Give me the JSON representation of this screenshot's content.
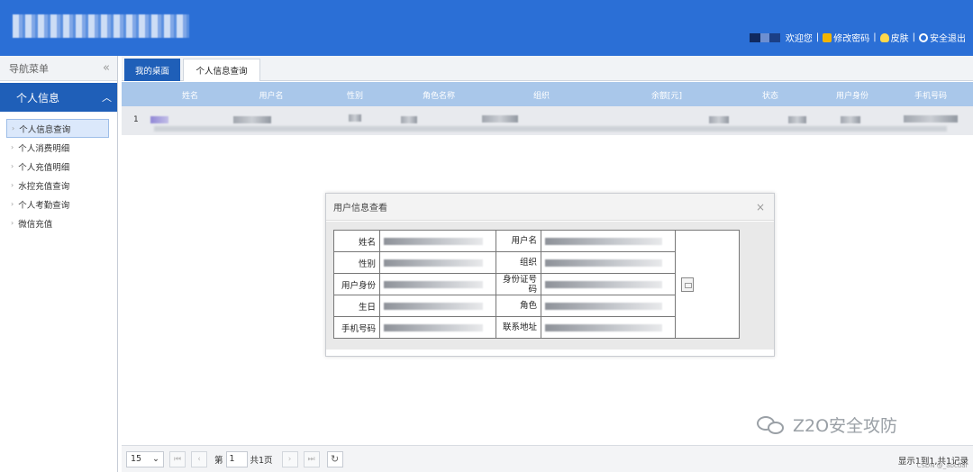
{
  "header": {
    "welcome": "欢迎您",
    "change_password": "修改密码",
    "skin": "皮肤",
    "logout": "安全退出",
    "separator": "|"
  },
  "sidebar": {
    "title": "导航菜单",
    "collapse": "«",
    "section": "个人信息",
    "items": [
      {
        "label": "个人信息查询",
        "active": true
      },
      {
        "label": "个人消费明细"
      },
      {
        "label": "个人充值明细"
      },
      {
        "label": "水控充值查询"
      },
      {
        "label": "个人考勤查询"
      },
      {
        "label": "微信充值"
      }
    ]
  },
  "tabs": {
    "home": "我的桌面",
    "info": "个人信息查询"
  },
  "grid": {
    "columns": [
      "姓名",
      "用户名",
      "性别",
      "角色名称",
      "组织",
      "余额[元]",
      "状态",
      "用户身份",
      "手机号码"
    ],
    "row_number": "1"
  },
  "dialog": {
    "title": "用户信息查看",
    "close": "×",
    "labels": {
      "name": "姓名",
      "username": "用户名",
      "gender": "性别",
      "org": "组织",
      "identity": "用户身份",
      "id_number": "身份证号码",
      "birthday": "生日",
      "role": "角色",
      "phone": "手机号码",
      "address": "联系地址"
    }
  },
  "pager": {
    "page_size": "15",
    "page_prefix": "第",
    "page_value": "1",
    "page_suffix": "共1页",
    "summary": "显示1到1,共1记录"
  },
  "watermark": {
    "text": "Z2O安全攻防",
    "source": "CSDN @_abcdaf"
  },
  "colors": {
    "header_bg": "#2b6fd6",
    "accent": "#1f5fb8",
    "grid_header": "#a9c7ea"
  }
}
